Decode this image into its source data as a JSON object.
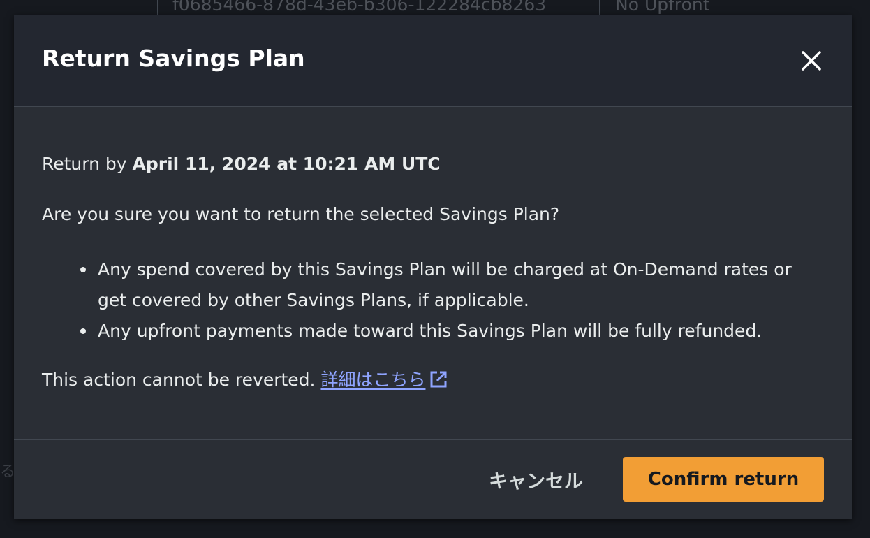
{
  "background": {
    "row_id": "f0685466-878d-43eb-b306-122284cb8263",
    "row_payment": "No Upfront",
    "left_glyph": "る"
  },
  "modal": {
    "title": "Return Savings Plan",
    "close_icon": "close-icon",
    "return_by_prefix": "Return by ",
    "return_by_date": "April 11, 2024 at 10:21 AM UTC",
    "question": "Are you sure you want to return the selected Savings Plan?",
    "bullets": [
      {
        "line1": "Any spend covered by this Savings Plan will be charged at On-Demand rates or",
        "line2": "get covered by other Savings Plans, if applicable."
      },
      {
        "line1": "Any upfront payments made toward this Savings Plan will be fully refunded.",
        "line2": ""
      }
    ],
    "cannot_revert": "This action cannot be reverted. ",
    "learn_more_link": "詳細はこちら",
    "external_icon": "external-link-icon",
    "cancel_label": "キャンセル",
    "confirm_label": "Confirm return"
  },
  "colors": {
    "accent": "#f29e35",
    "link": "#8fa4ff",
    "modal_bg": "#2a2e35",
    "header_bg": "#232730",
    "page_bg": "#16191f"
  }
}
